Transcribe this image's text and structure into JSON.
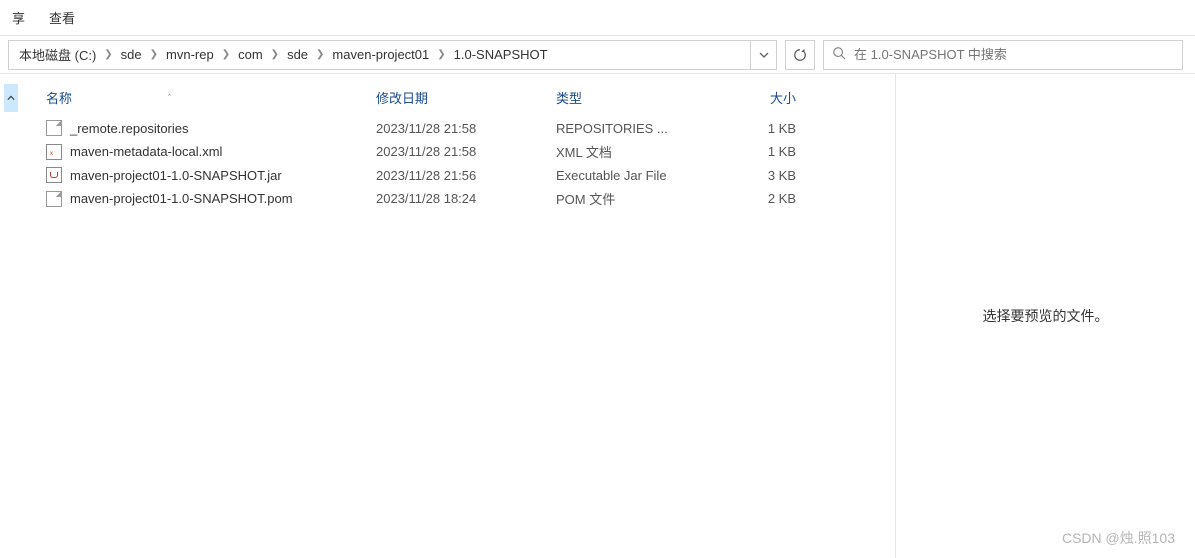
{
  "menu": {
    "share": "享",
    "view": "查看"
  },
  "breadcrumb": [
    "本地磁盘 (C:)",
    "sde",
    "mvn-rep",
    "com",
    "sde",
    "maven-project01",
    "1.0-SNAPSHOT"
  ],
  "search": {
    "placeholder": "在 1.0-SNAPSHOT 中搜索"
  },
  "columns": {
    "name": "名称",
    "date": "修改日期",
    "type": "类型",
    "size": "大小"
  },
  "files": [
    {
      "icon": "doc",
      "name": "_remote.repositories",
      "date": "2023/11/28 21:58",
      "type": "REPOSITORIES ...",
      "size": "1 KB"
    },
    {
      "icon": "xml",
      "name": "maven-metadata-local.xml",
      "date": "2023/11/28 21:58",
      "type": "XML 文档",
      "size": "1 KB"
    },
    {
      "icon": "jar",
      "name": "maven-project01-1.0-SNAPSHOT.jar",
      "date": "2023/11/28 21:56",
      "type": "Executable Jar File",
      "size": "3 KB"
    },
    {
      "icon": "pom",
      "name": "maven-project01-1.0-SNAPSHOT.pom",
      "date": "2023/11/28 18:24",
      "type": "POM 文件",
      "size": "2 KB"
    }
  ],
  "preview": {
    "empty_text": "选择要预览的文件。"
  },
  "watermark": "CSDN @烛.照103"
}
